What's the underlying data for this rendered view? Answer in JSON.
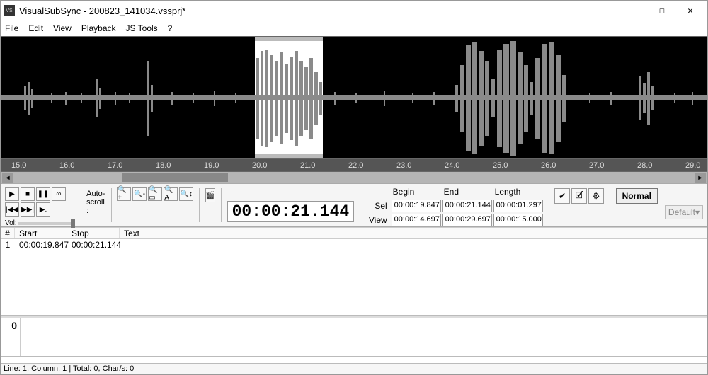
{
  "title": "VisualSubSync - 200823_141034.vssprj*",
  "menu": [
    "File",
    "Edit",
    "View",
    "Playback",
    "JS Tools",
    "?"
  ],
  "ruler_ticks": [
    "15.0",
    "16.0",
    "17.0",
    "18.0",
    "19.0",
    "20.0",
    "21.0",
    "22.0",
    "23.0",
    "24.0",
    "25.0",
    "26.0",
    "27.0",
    "28.0",
    "29.0"
  ],
  "autoscroll": "Auto-scroll :",
  "big_time": "00:00:21.144",
  "time_grid": {
    "headers": [
      "Begin",
      "End",
      "Length"
    ],
    "sel_label": "Sel",
    "view_label": "View",
    "sel": {
      "begin": "00:00:19.847",
      "end": "00:00:21.144",
      "length": "00:00:01.297"
    },
    "view": {
      "begin": "00:00:14.697",
      "end": "00:00:29.697",
      "length": "00:00:15.000"
    }
  },
  "normal_btn": "Normal",
  "style_select": "Default",
  "vol_label": "Vol:",
  "list": {
    "headers": [
      "#",
      "Start",
      "Stop",
      "Text"
    ],
    "rows": [
      {
        "idx": "1",
        "start": "00:00:19.847",
        "stop": "00:00:21.144",
        "text": ""
      }
    ]
  },
  "editor": {
    "line_num": "0",
    "text": ""
  },
  "status": "Line: 1, Column: 1 | Total: 0, Char/s: 0"
}
